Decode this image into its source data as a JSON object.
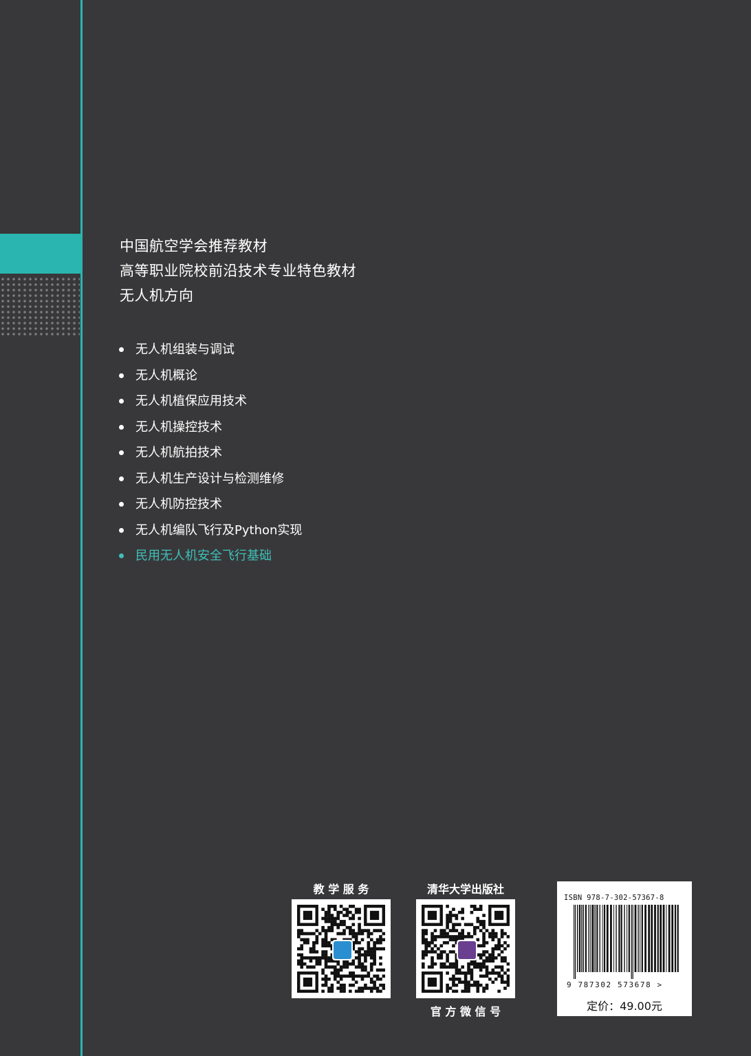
{
  "colors": {
    "background": "#38383a",
    "accent": "#2ab5b0",
    "highlight_text": "#3fbfb9"
  },
  "series": {
    "line1": "中国航空学会推荐教材",
    "line2": "高等职业院校前沿技术专业特色教材",
    "line3": "无人机方向"
  },
  "books": [
    "无人机组装与调试",
    "无人机概论",
    "无人机植保应用技术",
    "无人机操控技术",
    "无人机航拍技术",
    "无人机生产设计与检测维修",
    "无人机防控技术",
    "无人机编队飞行及Python实现",
    "民用无人机安全飞行基础"
  ],
  "qr1": {
    "caption": "教 学 服 务"
  },
  "qr2": {
    "caption_top": "清华大学出版社",
    "caption_bottom": "官 方 微 信 号"
  },
  "barcode": {
    "isbn": "ISBN 978-7-302-57367-8",
    "digits": "9 787302 573678 >",
    "price": "定价：49.00元"
  }
}
